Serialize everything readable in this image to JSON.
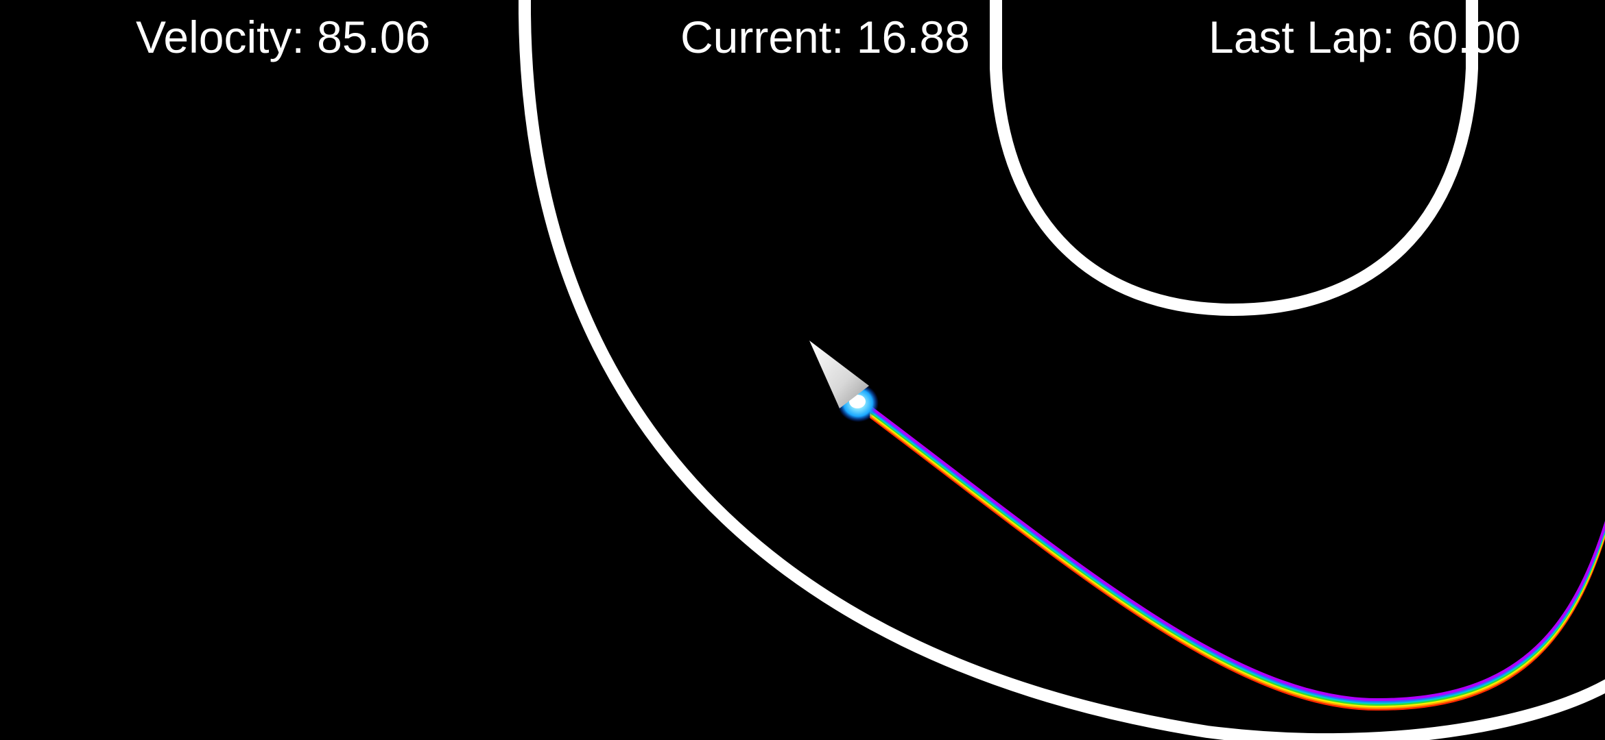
{
  "hud": {
    "velocity_label": "Velocity:",
    "velocity_value": "85.06",
    "current_label": "Current:",
    "current_value": "16.88",
    "last_lap_label": "Last Lap:",
    "last_lap_value": "60.00"
  },
  "colors": {
    "background": "#000000",
    "track_walls": "#ffffff",
    "hud_text": "#ffffff",
    "ship_body": "#e0e0e0",
    "thruster_glow": "#1aa8ff",
    "trail": [
      "#ff2a00",
      "#ff9a00",
      "#ffee00",
      "#33dd33",
      "#00c8d8",
      "#2a6cff",
      "#b000ff"
    ]
  },
  "icons": {
    "ship": "arrowhead-ship-icon",
    "thruster": "thruster-flame-icon"
  }
}
